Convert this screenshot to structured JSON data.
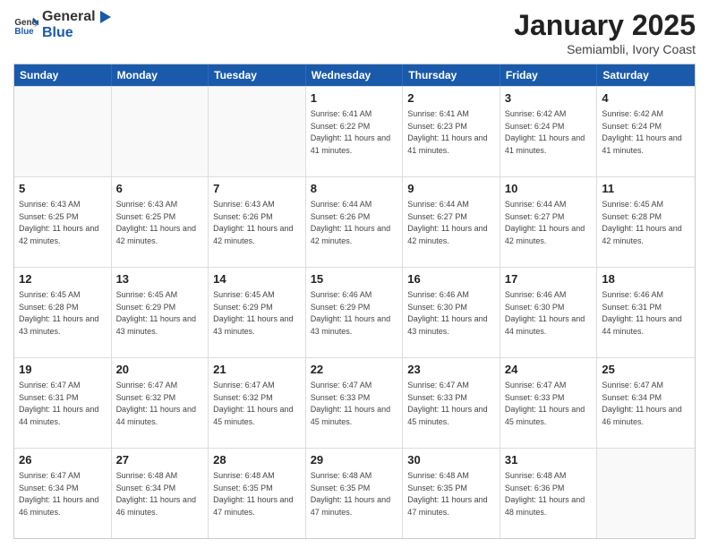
{
  "header": {
    "logo": {
      "general": "General",
      "blue": "Blue"
    },
    "title": "January 2025",
    "subtitle": "Semiambli, Ivory Coast"
  },
  "calendar": {
    "days_of_week": [
      "Sunday",
      "Monday",
      "Tuesday",
      "Wednesday",
      "Thursday",
      "Friday",
      "Saturday"
    ],
    "weeks": [
      [
        {
          "day": "",
          "sunrise": "",
          "sunset": "",
          "daylight": "",
          "empty": true
        },
        {
          "day": "",
          "sunrise": "",
          "sunset": "",
          "daylight": "",
          "empty": true
        },
        {
          "day": "",
          "sunrise": "",
          "sunset": "",
          "daylight": "",
          "empty": true
        },
        {
          "day": "1",
          "sunrise": "Sunrise: 6:41 AM",
          "sunset": "Sunset: 6:22 PM",
          "daylight": "Daylight: 11 hours and 41 minutes.",
          "empty": false
        },
        {
          "day": "2",
          "sunrise": "Sunrise: 6:41 AM",
          "sunset": "Sunset: 6:23 PM",
          "daylight": "Daylight: 11 hours and 41 minutes.",
          "empty": false
        },
        {
          "day": "3",
          "sunrise": "Sunrise: 6:42 AM",
          "sunset": "Sunset: 6:24 PM",
          "daylight": "Daylight: 11 hours and 41 minutes.",
          "empty": false
        },
        {
          "day": "4",
          "sunrise": "Sunrise: 6:42 AM",
          "sunset": "Sunset: 6:24 PM",
          "daylight": "Daylight: 11 hours and 41 minutes.",
          "empty": false
        }
      ],
      [
        {
          "day": "5",
          "sunrise": "Sunrise: 6:43 AM",
          "sunset": "Sunset: 6:25 PM",
          "daylight": "Daylight: 11 hours and 42 minutes.",
          "empty": false
        },
        {
          "day": "6",
          "sunrise": "Sunrise: 6:43 AM",
          "sunset": "Sunset: 6:25 PM",
          "daylight": "Daylight: 11 hours and 42 minutes.",
          "empty": false
        },
        {
          "day": "7",
          "sunrise": "Sunrise: 6:43 AM",
          "sunset": "Sunset: 6:26 PM",
          "daylight": "Daylight: 11 hours and 42 minutes.",
          "empty": false
        },
        {
          "day": "8",
          "sunrise": "Sunrise: 6:44 AM",
          "sunset": "Sunset: 6:26 PM",
          "daylight": "Daylight: 11 hours and 42 minutes.",
          "empty": false
        },
        {
          "day": "9",
          "sunrise": "Sunrise: 6:44 AM",
          "sunset": "Sunset: 6:27 PM",
          "daylight": "Daylight: 11 hours and 42 minutes.",
          "empty": false
        },
        {
          "day": "10",
          "sunrise": "Sunrise: 6:44 AM",
          "sunset": "Sunset: 6:27 PM",
          "daylight": "Daylight: 11 hours and 42 minutes.",
          "empty": false
        },
        {
          "day": "11",
          "sunrise": "Sunrise: 6:45 AM",
          "sunset": "Sunset: 6:28 PM",
          "daylight": "Daylight: 11 hours and 42 minutes.",
          "empty": false
        }
      ],
      [
        {
          "day": "12",
          "sunrise": "Sunrise: 6:45 AM",
          "sunset": "Sunset: 6:28 PM",
          "daylight": "Daylight: 11 hours and 43 minutes.",
          "empty": false
        },
        {
          "day": "13",
          "sunrise": "Sunrise: 6:45 AM",
          "sunset": "Sunset: 6:29 PM",
          "daylight": "Daylight: 11 hours and 43 minutes.",
          "empty": false
        },
        {
          "day": "14",
          "sunrise": "Sunrise: 6:45 AM",
          "sunset": "Sunset: 6:29 PM",
          "daylight": "Daylight: 11 hours and 43 minutes.",
          "empty": false
        },
        {
          "day": "15",
          "sunrise": "Sunrise: 6:46 AM",
          "sunset": "Sunset: 6:29 PM",
          "daylight": "Daylight: 11 hours and 43 minutes.",
          "empty": false
        },
        {
          "day": "16",
          "sunrise": "Sunrise: 6:46 AM",
          "sunset": "Sunset: 6:30 PM",
          "daylight": "Daylight: 11 hours and 43 minutes.",
          "empty": false
        },
        {
          "day": "17",
          "sunrise": "Sunrise: 6:46 AM",
          "sunset": "Sunset: 6:30 PM",
          "daylight": "Daylight: 11 hours and 44 minutes.",
          "empty": false
        },
        {
          "day": "18",
          "sunrise": "Sunrise: 6:46 AM",
          "sunset": "Sunset: 6:31 PM",
          "daylight": "Daylight: 11 hours and 44 minutes.",
          "empty": false
        }
      ],
      [
        {
          "day": "19",
          "sunrise": "Sunrise: 6:47 AM",
          "sunset": "Sunset: 6:31 PM",
          "daylight": "Daylight: 11 hours and 44 minutes.",
          "empty": false
        },
        {
          "day": "20",
          "sunrise": "Sunrise: 6:47 AM",
          "sunset": "Sunset: 6:32 PM",
          "daylight": "Daylight: 11 hours and 44 minutes.",
          "empty": false
        },
        {
          "day": "21",
          "sunrise": "Sunrise: 6:47 AM",
          "sunset": "Sunset: 6:32 PM",
          "daylight": "Daylight: 11 hours and 45 minutes.",
          "empty": false
        },
        {
          "day": "22",
          "sunrise": "Sunrise: 6:47 AM",
          "sunset": "Sunset: 6:33 PM",
          "daylight": "Daylight: 11 hours and 45 minutes.",
          "empty": false
        },
        {
          "day": "23",
          "sunrise": "Sunrise: 6:47 AM",
          "sunset": "Sunset: 6:33 PM",
          "daylight": "Daylight: 11 hours and 45 minutes.",
          "empty": false
        },
        {
          "day": "24",
          "sunrise": "Sunrise: 6:47 AM",
          "sunset": "Sunset: 6:33 PM",
          "daylight": "Daylight: 11 hours and 45 minutes.",
          "empty": false
        },
        {
          "day": "25",
          "sunrise": "Sunrise: 6:47 AM",
          "sunset": "Sunset: 6:34 PM",
          "daylight": "Daylight: 11 hours and 46 minutes.",
          "empty": false
        }
      ],
      [
        {
          "day": "26",
          "sunrise": "Sunrise: 6:47 AM",
          "sunset": "Sunset: 6:34 PM",
          "daylight": "Daylight: 11 hours and 46 minutes.",
          "empty": false
        },
        {
          "day": "27",
          "sunrise": "Sunrise: 6:48 AM",
          "sunset": "Sunset: 6:34 PM",
          "daylight": "Daylight: 11 hours and 46 minutes.",
          "empty": false
        },
        {
          "day": "28",
          "sunrise": "Sunrise: 6:48 AM",
          "sunset": "Sunset: 6:35 PM",
          "daylight": "Daylight: 11 hours and 47 minutes.",
          "empty": false
        },
        {
          "day": "29",
          "sunrise": "Sunrise: 6:48 AM",
          "sunset": "Sunset: 6:35 PM",
          "daylight": "Daylight: 11 hours and 47 minutes.",
          "empty": false
        },
        {
          "day": "30",
          "sunrise": "Sunrise: 6:48 AM",
          "sunset": "Sunset: 6:35 PM",
          "daylight": "Daylight: 11 hours and 47 minutes.",
          "empty": false
        },
        {
          "day": "31",
          "sunrise": "Sunrise: 6:48 AM",
          "sunset": "Sunset: 6:36 PM",
          "daylight": "Daylight: 11 hours and 48 minutes.",
          "empty": false
        },
        {
          "day": "",
          "sunrise": "",
          "sunset": "",
          "daylight": "",
          "empty": true
        }
      ]
    ]
  }
}
